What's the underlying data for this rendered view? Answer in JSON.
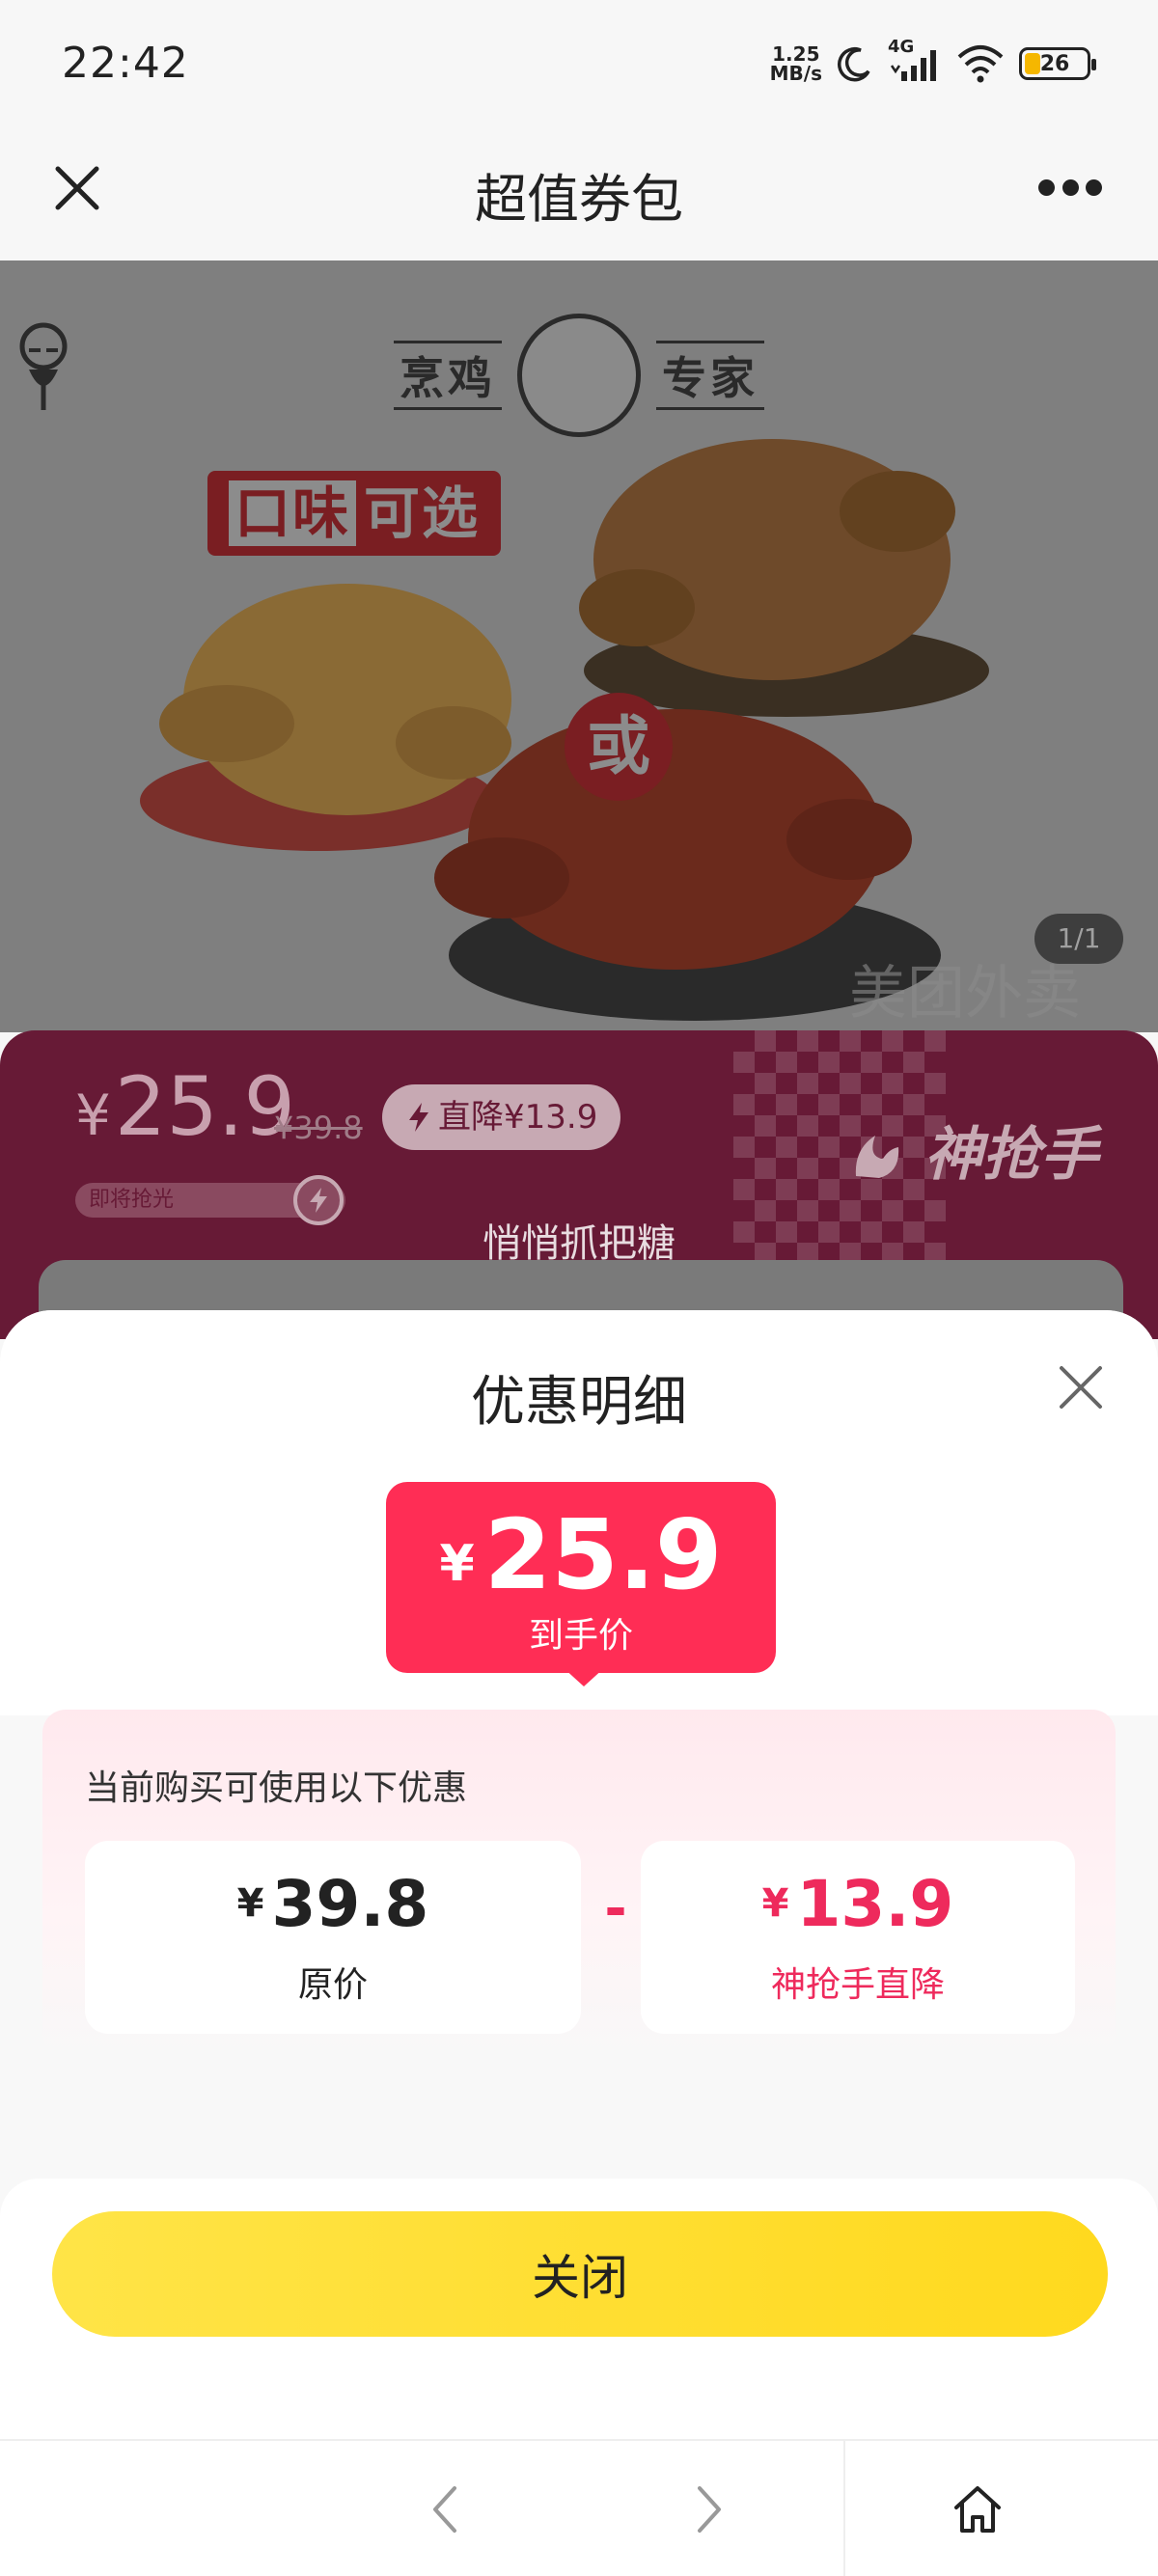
{
  "status_bar": {
    "time": "22:42",
    "net_speed_value": "1.25",
    "net_speed_unit": "MB/s",
    "network": "4G",
    "battery": "26",
    "battery_level": 0.26,
    "icons": [
      "moon-icon",
      "signal-icon",
      "wifi-icon",
      "battery-icon"
    ]
  },
  "nav": {
    "title": "超值券包",
    "close_icon": "close-icon",
    "more_icon": "more-icon"
  },
  "hero": {
    "logo_left": "烹鸡",
    "logo_right": "专家",
    "flavor_tag_a": "口味",
    "flavor_tag_b": "可选",
    "or_badge": "或",
    "page_indicator": "1/1"
  },
  "price_banner": {
    "currency": "¥",
    "price": "25.9",
    "original_price": "¥39.8",
    "drop_label": "直降¥13.9",
    "stock_bar_label": "即将抢光",
    "brand": "神抢手",
    "subtitle": "悄悄抓把糖"
  },
  "discount_sheet": {
    "title": "优惠明细",
    "final_currency": "¥",
    "final_price": "25.9",
    "final_label": "到手价",
    "caption": "当前购买可使用以下优惠",
    "original": {
      "currency": "¥",
      "amount": "39.8",
      "label": "原价"
    },
    "operator": "-",
    "discount": {
      "currency": "¥",
      "amount": "13.9",
      "label": "神抢手直降"
    },
    "close_button": "关闭",
    "accent_color": "#ff2d55",
    "button_color": "#ffde30"
  },
  "bottom_bar": {
    "icons": [
      "back-arrow-icon",
      "forward-arrow-icon",
      "home-icon"
    ]
  }
}
